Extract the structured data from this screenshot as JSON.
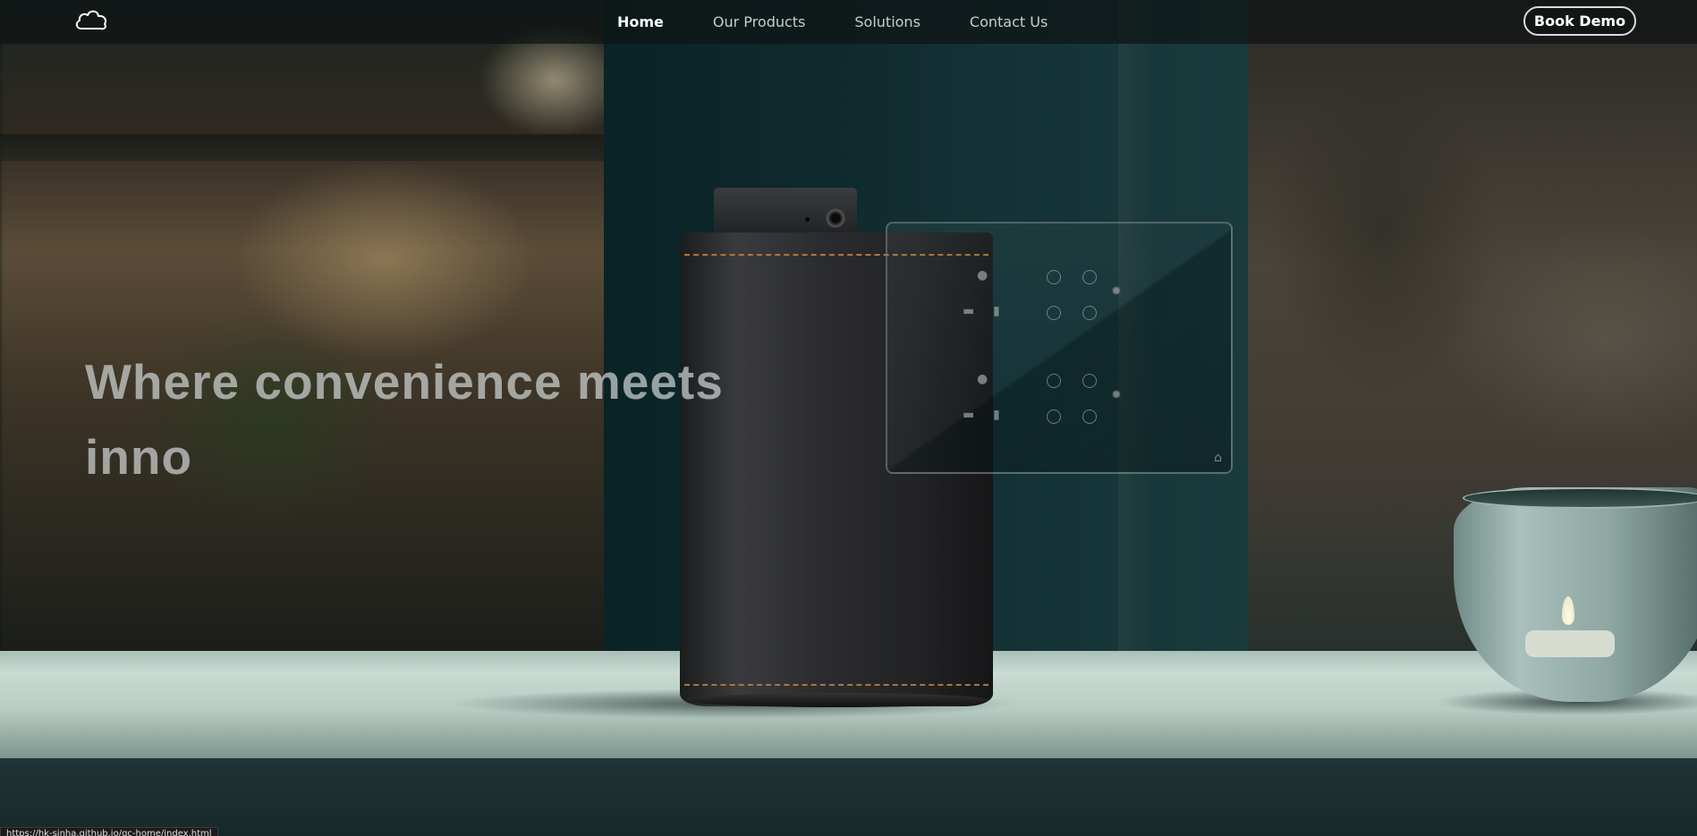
{
  "nav": {
    "logo_icon": "cloud-icon",
    "links": [
      {
        "label": "Home",
        "active": true
      },
      {
        "label": "Our Products",
        "active": false
      },
      {
        "label": "Solutions",
        "active": false
      },
      {
        "label": "Contact Us",
        "active": false
      }
    ],
    "cta_label": "Book Demo"
  },
  "hero": {
    "heading": "Where convenience meets inno"
  },
  "panel": {
    "icon": "home-icon"
  },
  "status_bar": {
    "url": "https://hk-sinha.github.io/gc-home/index.html"
  },
  "colors": {
    "nav_background": "#0e1414",
    "accent_text": "#ffffff",
    "hero_text": "#cdd2d2",
    "stitch": "#b0743c"
  }
}
